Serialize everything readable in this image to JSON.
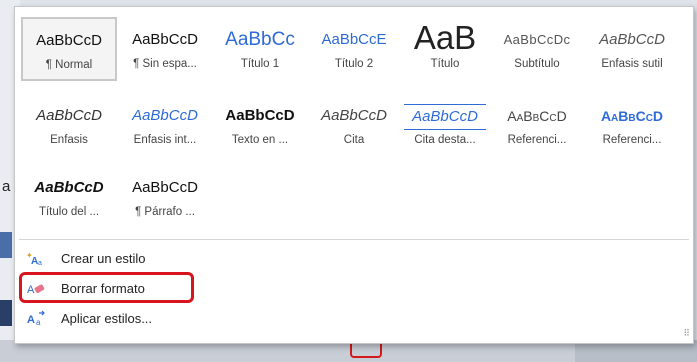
{
  "background": {
    "left_fragment": "a"
  },
  "styles": [
    {
      "name": "¶ Normal",
      "sample": "AaBbCcD",
      "style": "normal",
      "selected": true
    },
    {
      "name": "¶ Sin espa...",
      "sample": "AaBbCcD",
      "style": "normal"
    },
    {
      "name": "Título 1",
      "sample": "AaBbCc",
      "style": "s-title1"
    },
    {
      "name": "Título 2",
      "sample": "AaBbCcE",
      "style": "s-title2"
    },
    {
      "name": "Título",
      "sample": "AaB",
      "style": "s-titulo"
    },
    {
      "name": "Subtítulo",
      "sample": "AaBbCcDc",
      "style": "s-subt"
    },
    {
      "name": "Énfasis sutil",
      "sample": "AaBbCcD",
      "style": "s-enf-sutil"
    },
    {
      "name": "Énfasis",
      "sample": "AaBbCcD",
      "style": "s-enf"
    },
    {
      "name": "Énfasis int...",
      "sample": "AaBbCcD",
      "style": "s-enf-int"
    },
    {
      "name": "Texto en ...",
      "sample": "AaBbCcD",
      "style": "s-texto"
    },
    {
      "name": "Cita",
      "sample": "AaBbCcD",
      "style": "s-cita"
    },
    {
      "name": "Cita desta...",
      "sample": "AaBbCcD",
      "style": "s-cita-d"
    },
    {
      "name": "Referenci...",
      "sample": "AaBbCcD",
      "style": "s-ref"
    },
    {
      "name": "Referenci...",
      "sample": "AaBbCcD",
      "style": "s-ref-int"
    },
    {
      "name": "Título del ...",
      "sample": "AaBbCcD",
      "style": "s-titulo-libro"
    },
    {
      "name": "¶ Párrafo ...",
      "sample": "AaBbCcD",
      "style": "normal"
    }
  ],
  "commands": [
    {
      "label": "Crear un estilo",
      "icon": "create-style-icon"
    },
    {
      "label": "Borrar formato",
      "icon": "eraser-icon",
      "highlighted": true
    },
    {
      "label": "Aplicar estilos...",
      "icon": "apply-styles-icon"
    }
  ],
  "colors": {
    "accent": "#2e6bd6",
    "highlight": "#d8141e",
    "popup_bg": "#ffffff"
  }
}
